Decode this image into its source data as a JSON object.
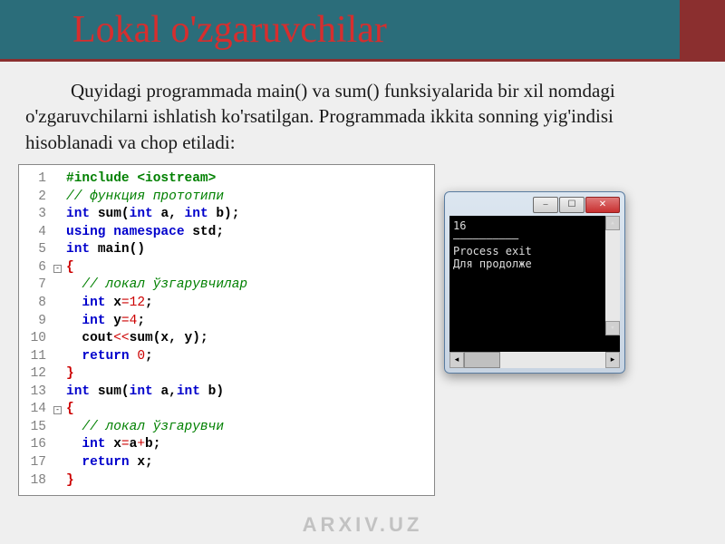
{
  "header": {
    "title": "Lokal o'zgaruvchilar"
  },
  "paragraph": "Quyidagi programmada main() va sum() funksiyalarida bir xil nomdagi o'zgaruvchilarni ishlatish ko'rsatilgan. Programmada ikkita sonning yig'indisi hisoblanadi va chop etiladi:",
  "code": {
    "lines": [
      {
        "n": "1",
        "html": "<span class='pp'>#include &lt;iostream&gt;</span>"
      },
      {
        "n": "2",
        "html": "<span class='cm'>// функция прототипи</span>"
      },
      {
        "n": "3",
        "html": "<span class='kw'>int</span> <span class='txt'>sum(</span><span class='kw'>int</span> <span class='txt'>a,</span> <span class='kw'>int</span> <span class='txt'>b);</span>"
      },
      {
        "n": "4",
        "html": "<span class='kw'>using namespace</span> <span class='txt'>std;</span>"
      },
      {
        "n": "5",
        "html": "<span class='kw'>int</span> <span class='txt'>main()</span>"
      },
      {
        "n": "6",
        "html": "<span class='br'>{</span>",
        "fold": true
      },
      {
        "n": "7",
        "html": "  <span class='cm'>// локал ўзгарувчилар</span>"
      },
      {
        "n": "8",
        "html": "  <span class='kw'>int</span> <span class='txt'>x</span><span class='op'>=</span><span class='num'>12</span><span class='txt'>;</span>"
      },
      {
        "n": "9",
        "html": "  <span class='kw'>int</span> <span class='txt'>y</span><span class='op'>=</span><span class='num'>4</span><span class='txt'>;</span>"
      },
      {
        "n": "10",
        "html": "  <span class='txt'>cout</span><span class='op'>&lt;&lt;</span><span class='txt'>sum(x, y);</span>"
      },
      {
        "n": "11",
        "html": "  <span class='kw'>return</span> <span class='num'>0</span><span class='txt'>;</span>"
      },
      {
        "n": "12",
        "html": "<span class='br'>}</span>"
      },
      {
        "n": "13",
        "html": "<span class='kw'>int</span> <span class='txt'>sum(</span><span class='kw'>int</span> <span class='txt'>a,</span><span class='kw'>int</span> <span class='txt'>b)</span>"
      },
      {
        "n": "14",
        "html": "<span class='br'>{</span>",
        "fold": true
      },
      {
        "n": "15",
        "html": "  <span class='cm'>// локал ўзгарувчи</span>"
      },
      {
        "n": "16",
        "html": "  <span class='kw'>int</span> <span class='txt'>x</span><span class='op'>=</span><span class='txt'>a</span><span class='op'>+</span><span class='txt'>b;</span>"
      },
      {
        "n": "17",
        "html": "  <span class='kw'>return</span> <span class='txt'>x;</span>"
      },
      {
        "n": "18",
        "html": "<span class='br'>}</span>"
      }
    ]
  },
  "console": {
    "lines": [
      "16",
      "——————————",
      "Process exit",
      "Для продолже"
    ]
  },
  "window_buttons": {
    "min_icon": "–",
    "max_icon": "☐",
    "close_icon": "✕"
  },
  "watermark": "ARXIV.UZ"
}
